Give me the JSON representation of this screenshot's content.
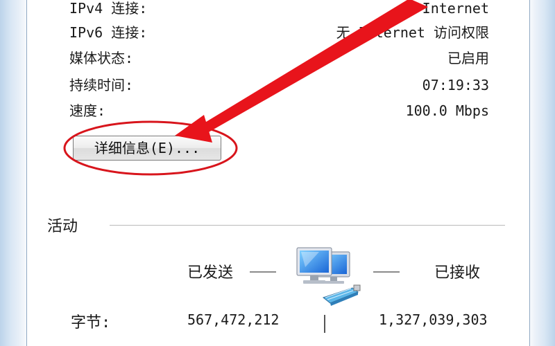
{
  "connection": {
    "ipv4_label": "IPv4 连接:",
    "ipv4_value": "Internet",
    "ipv6_label": "IPv6 连接:",
    "ipv6_value": "无 Internet 访问权限",
    "media_label": "媒体状态:",
    "media_value": "已启用",
    "duration_label": "持续时间:",
    "duration_value": "07:19:33",
    "speed_label": "速度:",
    "speed_value": "100.0 Mbps"
  },
  "details_button": "详细信息(E)...",
  "activity": {
    "title": "活动",
    "sent_label": "已发送",
    "received_label": "已接收",
    "bytes_label": "字节:",
    "bytes_sent": "567,472,212",
    "bytes_received": "1,327,039,303"
  },
  "annotation": {
    "arrow_color": "#e8141b",
    "circle_color": "#d8151c"
  },
  "icons": {
    "network": "network-computers-icon"
  }
}
